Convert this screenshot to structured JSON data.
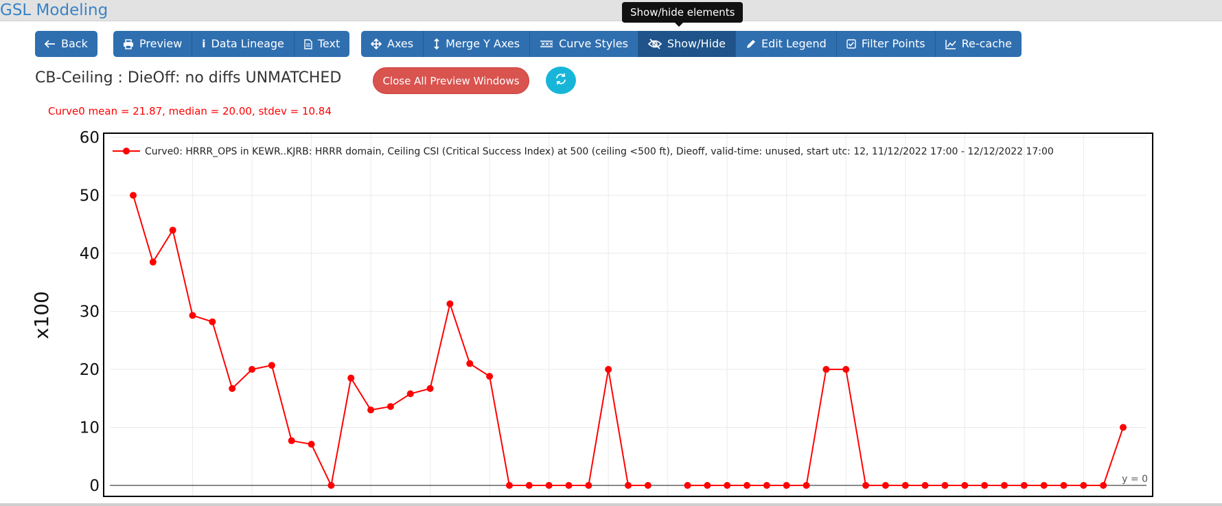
{
  "app": {
    "title": "GSL Modeling"
  },
  "tooltip": "Show/hide elements",
  "toolbar": {
    "back": "Back",
    "preview": "Preview",
    "data_lineage": "Data Lineage",
    "text": "Text",
    "axes": "Axes",
    "merge_y_axes": "Merge Y Axes",
    "curve_styles": "Curve Styles",
    "show_hide": "Show/Hide",
    "edit_legend": "Edit Legend",
    "filter_points": "Filter Points",
    "recache": "Re-cache"
  },
  "plot": {
    "title": "CB-Ceiling : DieOff: no diffs UNMATCHED",
    "close_all_label": "Close All Preview Windows",
    "stats": "Curve0 mean = 21.87, median = 20.00, stdev = 10.84"
  },
  "chart_data": {
    "type": "line",
    "title": "",
    "xlabel": "",
    "ylabel": "x100",
    "ylim": [
      0,
      60
    ],
    "yticks": [
      0,
      10,
      20,
      30,
      40,
      50,
      60
    ],
    "grid": true,
    "legend_placement": "top",
    "annotation": "y = 0",
    "colors": {
      "series": "#ff0000",
      "zero_line": "#444444"
    },
    "x": [
      0,
      1,
      2,
      3,
      4,
      5,
      6,
      7,
      8,
      9,
      10,
      11,
      12,
      13,
      14,
      15,
      16,
      17,
      18,
      19,
      20,
      21,
      22,
      23,
      24,
      25,
      26,
      27,
      28,
      29,
      30,
      31,
      32,
      33,
      34,
      35,
      36,
      37,
      38,
      39,
      40,
      41,
      42,
      43,
      44,
      45,
      46,
      47,
      48,
      49,
      50
    ],
    "series": [
      {
        "name": "Curve0: HRRR_OPS in KEWR..KJRB: HRRR domain, Ceiling CSI (Critical Success Index) at 500 (ceiling <500 ft), Dieoff, valid-time: unused, start utc: 12, 11/12/2022 17:00 - 12/12/2022 17:00",
        "values": [
          50,
          38.5,
          44,
          29.3,
          28.2,
          16.7,
          20,
          20.7,
          7.7,
          7.1,
          0,
          18.5,
          13,
          13.6,
          15.8,
          16.7,
          31.3,
          21,
          18.8,
          0,
          0,
          0,
          0,
          0,
          20,
          0,
          0,
          null,
          0,
          0,
          0,
          0,
          0,
          0,
          0,
          20,
          20,
          0,
          0,
          0,
          0,
          0,
          0,
          0,
          0,
          0,
          0,
          0,
          0,
          0,
          10
        ]
      }
    ]
  }
}
